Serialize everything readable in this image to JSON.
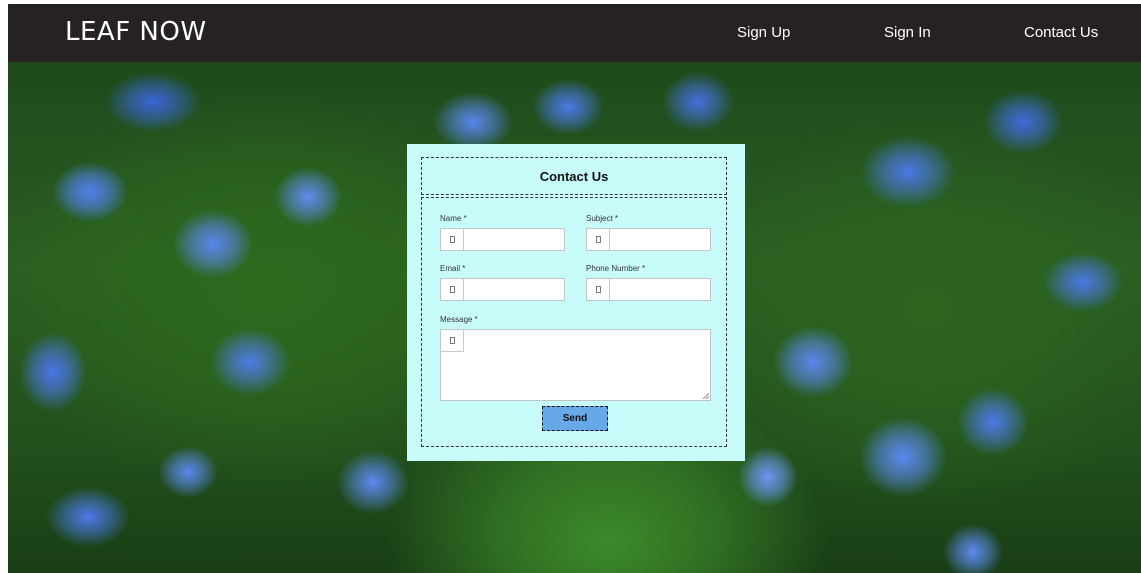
{
  "navbar": {
    "brand": "LEAF NOW",
    "links": [
      "Sign Up",
      "Sign In",
      "Contact Us"
    ]
  },
  "form": {
    "title": "Contact Us",
    "name_label": "Name *",
    "subject_label": "Subject *",
    "email_label": "Email *",
    "phone_label": "Phone Number *",
    "message_label": "Message *",
    "name_value": "",
    "subject_value": "",
    "email_value": "",
    "phone_value": "",
    "message_value": "",
    "send_label": "Send"
  },
  "colors": {
    "navbar_bg": "#262223",
    "card_bg": "#c8fcfb",
    "send_button": "#66a8e8"
  },
  "icons": {
    "field_icon": "placeholder-box-icon"
  }
}
